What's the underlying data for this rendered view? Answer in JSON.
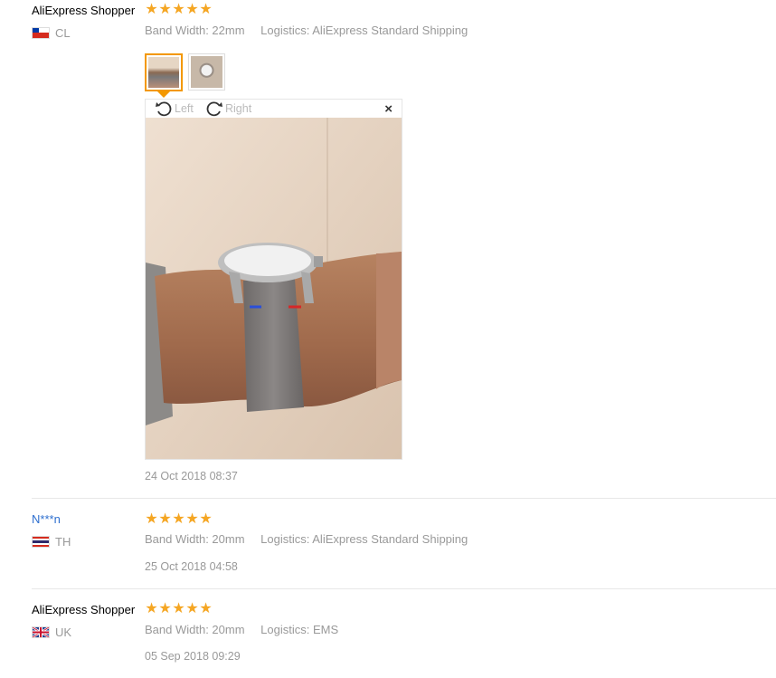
{
  "reviews": [
    {
      "name": "AliExpress Shopper",
      "country": "CL",
      "flag": "chile",
      "rating": 5,
      "band_width": "Band Width: 22mm",
      "logistics": "Logistics: AliExpress Standard Shipping",
      "date": "24 Oct 2018 08:37",
      "viewer": {
        "rotate_left": "Left",
        "rotate_right": "Right",
        "close": "×"
      }
    },
    {
      "name": "N***n",
      "country": "TH",
      "flag": "thailand",
      "rating": 5,
      "band_width": "Band Width: 20mm",
      "logistics": "Logistics: AliExpress Standard Shipping",
      "date": "25 Oct 2018 04:58"
    },
    {
      "name": "AliExpress Shopper",
      "country": "UK",
      "flag": "uk",
      "rating": 5,
      "band_width": "Band Width: 20mm",
      "logistics": "Logistics: EMS",
      "date": "05 Sep 2018 09:29"
    }
  ],
  "colors": {
    "star": "#f5a623",
    "accent": "#f39800",
    "link": "#2e6fcf",
    "muted": "#999999"
  }
}
